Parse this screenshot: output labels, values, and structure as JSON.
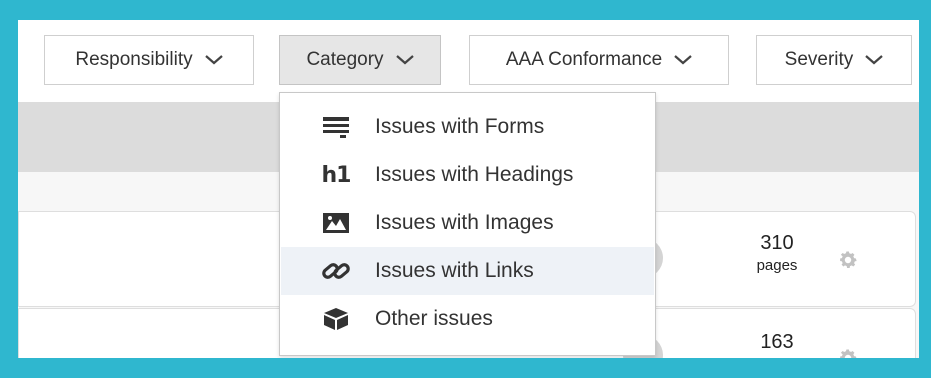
{
  "filters": {
    "responsibility": "Responsibility",
    "category": "Category",
    "conformance": "AAA Conformance",
    "severity": "Severity"
  },
  "category_menu": {
    "items": [
      {
        "label": "Issues with Forms",
        "icon": "form-icon"
      },
      {
        "label": "Issues with Headings",
        "icon": "h1-heading-icon",
        "glyph": "h1"
      },
      {
        "label": "Issues with Images",
        "icon": "image-icon"
      },
      {
        "label": "Issues with Links",
        "icon": "link-icon",
        "highlighted": true
      },
      {
        "label": "Other issues",
        "icon": "box-icon"
      }
    ]
  },
  "rows": [
    {
      "count": "310",
      "unit": "pages"
    },
    {
      "count": "163"
    }
  ],
  "colors": {
    "frame_border": "#2fb7cf",
    "menu_hover": "#eef2f7",
    "gray_band": "#dcdcdc"
  }
}
